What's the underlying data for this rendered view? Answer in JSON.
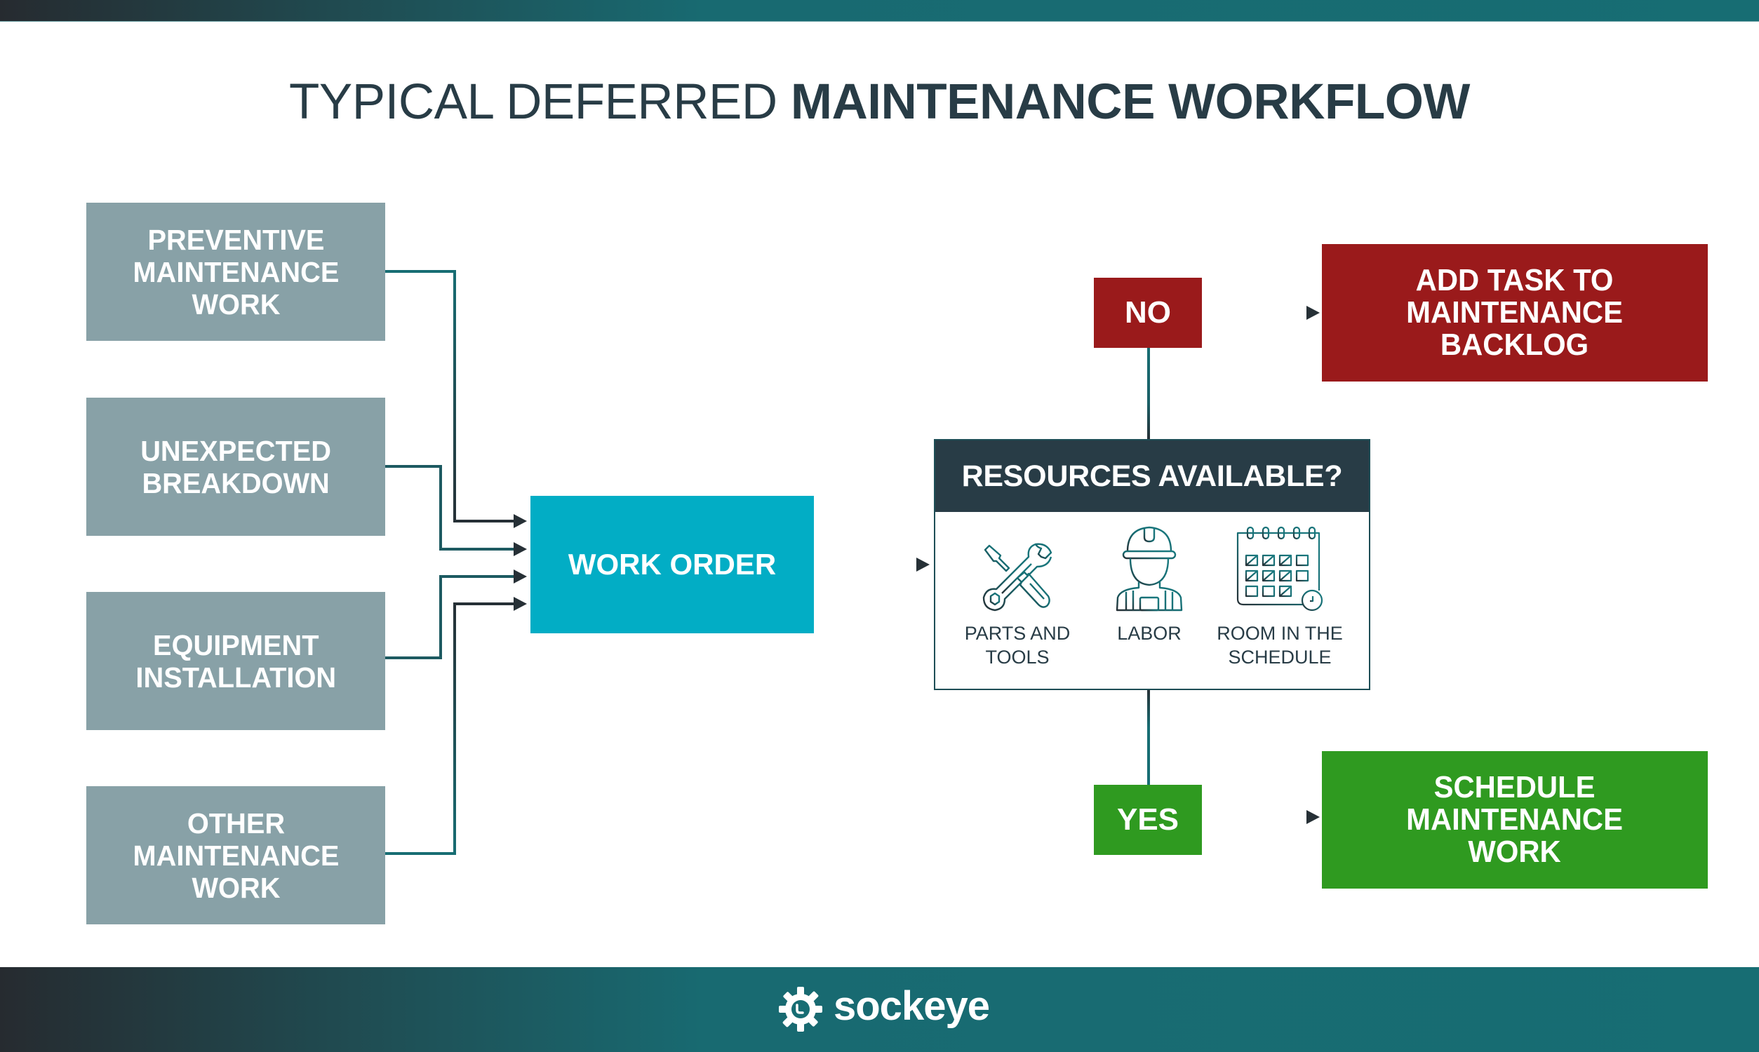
{
  "title": {
    "light": "TYPICAL DEFERRED",
    "bold": "MAINTENANCE WORKFLOW"
  },
  "sources": [
    {
      "label": "PREVENTIVE\nMAINTENANCE\nWORK"
    },
    {
      "label": "UNEXPECTED\nBREAKDOWN"
    },
    {
      "label": "EQUIPMENT\nINSTALLATION"
    },
    {
      "label": "OTHER\nMAINTENANCE\nWORK"
    }
  ],
  "work_order": {
    "label": "WORK ORDER"
  },
  "resources": {
    "header": "RESOURCES AVAILABLE?",
    "items": [
      {
        "icon": "tools-icon",
        "label": "PARTS AND\nTOOLS"
      },
      {
        "icon": "worker-icon",
        "label": "LABOR"
      },
      {
        "icon": "calendar-icon",
        "label": "ROOM IN THE\nSCHEDULE"
      }
    ]
  },
  "decisions": {
    "no": {
      "label": "NO",
      "outcome": "ADD TASK TO\nMAINTENANCE\nBACKLOG"
    },
    "yes": {
      "label": "YES",
      "outcome": "SCHEDULE\nMAINTENANCE\nWORK"
    }
  },
  "colors": {
    "source_gray": "#88a1a7",
    "work_order_cyan": "#02adc5",
    "header_dark": "#283c46",
    "no_red": "#9a1a1b",
    "yes_green": "#2f9a20",
    "brand_teal": "#176d73"
  },
  "footer": {
    "brand": "sockeye",
    "logo_icon": "sockeye-gear-icon"
  }
}
